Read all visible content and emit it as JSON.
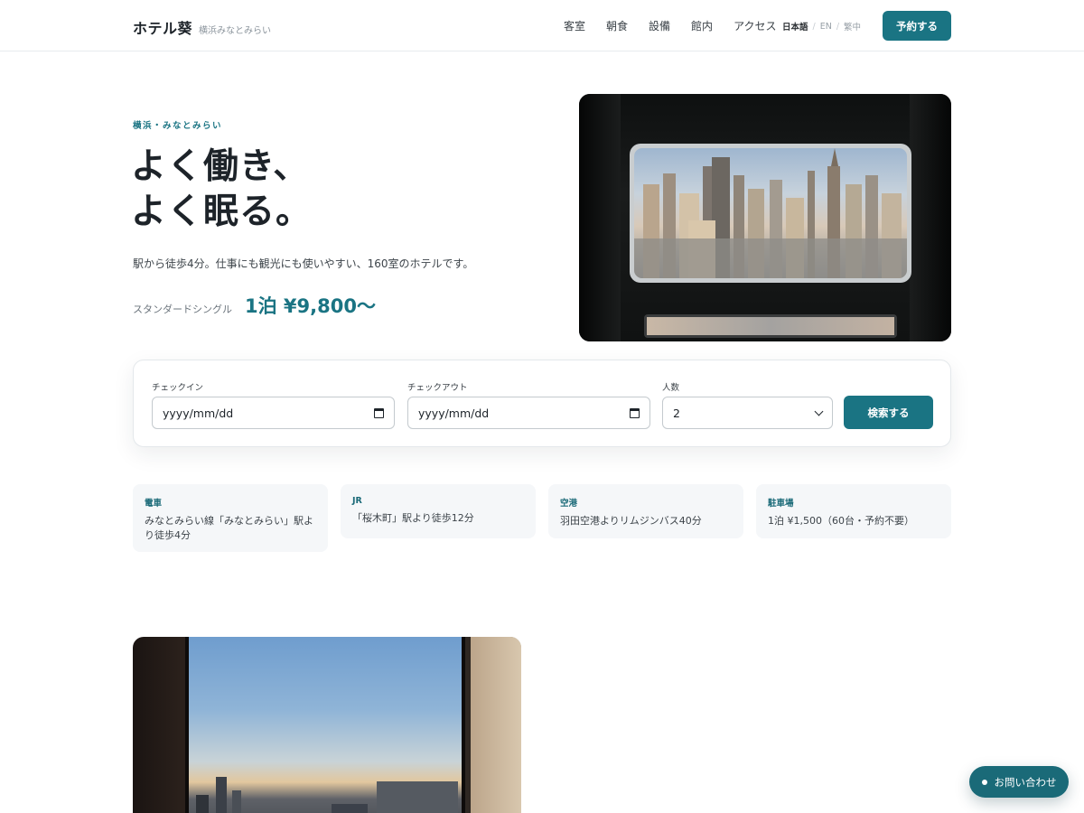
{
  "header": {
    "brand_name": "ホテル葵",
    "brand_sub": "横浜みなとみらい",
    "nav": [
      "客室",
      "朝食",
      "設備",
      "館内",
      "アクセス"
    ],
    "languages": [
      "日本語",
      "EN",
      "繁中"
    ],
    "active_language": "日本語",
    "reserve_label": "予約する"
  },
  "hero": {
    "eyebrow": "横浜・みなとみらい",
    "headline_line1": "よく働き、",
    "headline_line2": "よく眠る。",
    "lead": "駅から徒歩4分。仕事にも観光にも使いやすい、160室のホテルです。",
    "price_label": "スタンダードシングル",
    "price": "1泊 ¥9,800〜"
  },
  "search": {
    "checkin_label": "チェックイン",
    "checkin_value": "yyyy/mm/dd",
    "checkout_label": "チェックアウト",
    "checkout_value": "yyyy/mm/dd",
    "guests_label": "人数",
    "guests_value": "2",
    "search_label": "検索する"
  },
  "access": [
    {
      "title": "電車",
      "body": "みなとみらい線「みなとみらい」駅より徒歩4分"
    },
    {
      "title": "JR",
      "body": "「桜木町」駅より徒歩12分"
    },
    {
      "title": "空港",
      "body": "羽田空港よりリムジンバス40分"
    },
    {
      "title": "駐車場",
      "body": "1泊 ¥1,500（60台・予約不要）"
    }
  ],
  "contact_label": "お問い合わせ",
  "colors": {
    "accent": "#1a7483",
    "text": "#1d2329",
    "card_bg": "#f5f7f9"
  }
}
